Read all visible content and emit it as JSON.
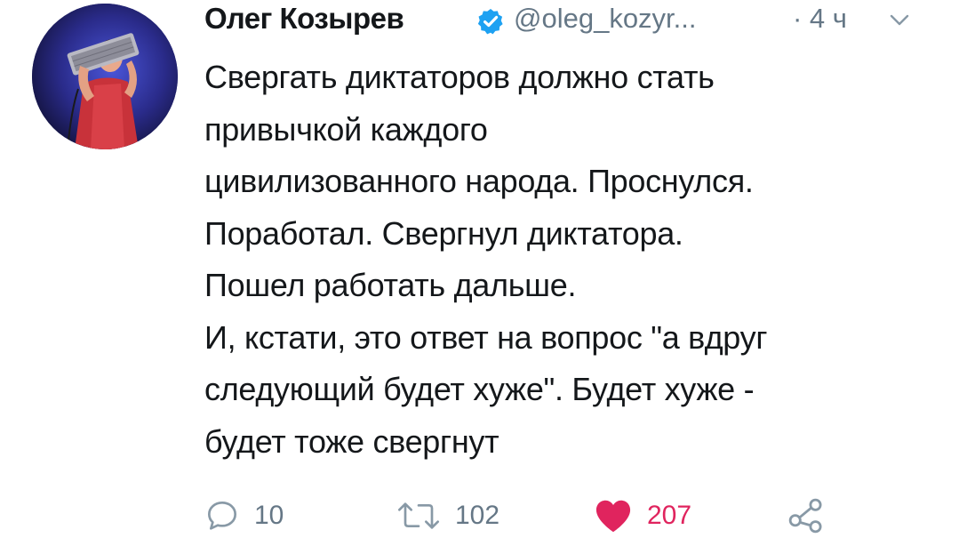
{
  "tweet": {
    "author_name": "Олег Козырев",
    "handle": "@oleg_kozyr...",
    "time": "· 4 ч",
    "verified_icon": "verified-badge-icon",
    "text_lines": [
      "Свергать диктаторов должно стать",
      "привычкой каждого",
      "цивилизованного народа. Проснулся.",
      "Поработал. Свергнул диктатора.",
      "Пошел работать дальше.",
      "И, кстати, это ответ на вопрос \"а вдруг",
      "следующий будет хуже\". Будет хуже -",
      "будет тоже свергнут"
    ]
  },
  "actions": {
    "reply": {
      "icon": "reply-icon",
      "count": "10"
    },
    "retweet": {
      "icon": "retweet-icon",
      "count": "102"
    },
    "like": {
      "icon": "heart-icon",
      "count": "207",
      "liked": true
    },
    "share": {
      "icon": "share-icon"
    }
  },
  "colors": {
    "text": "#14171a",
    "secondary": "#657786",
    "verified": "#1da1f2",
    "like": "#e0245e"
  }
}
